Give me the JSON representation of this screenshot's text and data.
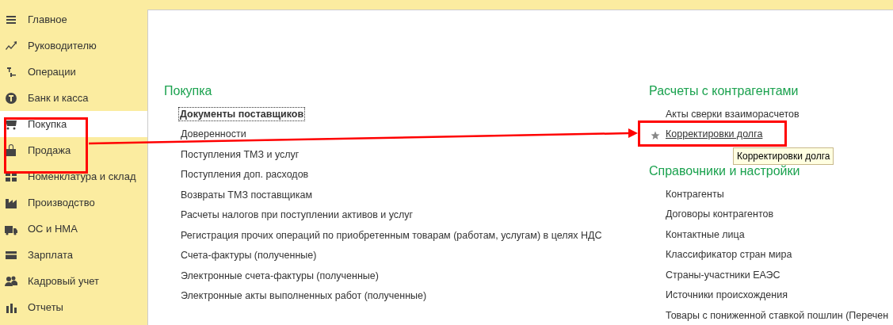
{
  "sidebar": {
    "items": [
      {
        "label": "Главное",
        "selected": false
      },
      {
        "label": "Руководителю",
        "selected": false
      },
      {
        "label": "Операции",
        "selected": false
      },
      {
        "label": "Банк и касса",
        "selected": false
      },
      {
        "label": "Покупка",
        "selected": true
      },
      {
        "label": "Продажа",
        "selected": false
      },
      {
        "label": "Номенклатура и склад",
        "selected": false
      },
      {
        "label": "Производство",
        "selected": false
      },
      {
        "label": "ОС и НМА",
        "selected": false
      },
      {
        "label": "Зарплата",
        "selected": false
      },
      {
        "label": "Кадровый учет",
        "selected": false
      },
      {
        "label": "Отчеты",
        "selected": false
      }
    ]
  },
  "sections": [
    {
      "title": "Покупка",
      "items": [
        {
          "label": "Документы поставщиков",
          "focused": true,
          "favorite": false,
          "hovered": false
        },
        {
          "label": "Доверенности",
          "focused": false,
          "favorite": false,
          "hovered": false
        },
        {
          "label": "Поступления ТМЗ и услуг",
          "focused": false,
          "favorite": false,
          "hovered": false
        },
        {
          "label": "Поступления доп. расходов",
          "focused": false,
          "favorite": false,
          "hovered": false
        },
        {
          "label": "Возвраты ТМЗ поставщикам",
          "focused": false,
          "favorite": false,
          "hovered": false
        },
        {
          "label": "Расчеты налогов при поступлении активов и услуг",
          "focused": false,
          "favorite": false,
          "hovered": false
        },
        {
          "label": "Регистрация прочих операций по приобретенным товарам (работам, услугам) в целях НДС",
          "focused": false,
          "favorite": false,
          "hovered": false
        },
        {
          "label": "Счета-фактуры (полученные)",
          "focused": false,
          "favorite": false,
          "hovered": false
        },
        {
          "label": "Электронные счета-фактуры (полученные)",
          "focused": false,
          "favorite": false,
          "hovered": false
        },
        {
          "label": "Электронные акты выполненных работ (полученные)",
          "focused": false,
          "favorite": false,
          "hovered": false
        }
      ]
    },
    {
      "title": "Расчеты с контрагентами",
      "items": [
        {
          "label": "Акты сверки взаиморасчетов",
          "focused": false,
          "favorite": false,
          "hovered": false
        },
        {
          "label": "Корректировки долга",
          "focused": false,
          "favorite": true,
          "hovered": true
        }
      ]
    },
    {
      "title": "Справочники и настройки",
      "items": [
        {
          "label": "Контрагенты",
          "focused": false,
          "favorite": false,
          "hovered": false
        },
        {
          "label": "Договоры контрагентов",
          "focused": false,
          "favorite": false,
          "hovered": false
        },
        {
          "label": "Контактные лица",
          "focused": false,
          "favorite": false,
          "hovered": false
        },
        {
          "label": "Классификатор стран мира",
          "focused": false,
          "favorite": false,
          "hovered": false
        },
        {
          "label": "Страны-участники ЕАЭС",
          "focused": false,
          "favorite": false,
          "hovered": false
        },
        {
          "label": "Источники происхождения",
          "focused": false,
          "favorite": false,
          "hovered": false
        },
        {
          "label": "Товары с пониженной ставкой пошлин (Перечен",
          "focused": false,
          "favorite": false,
          "hovered": false
        }
      ]
    }
  ],
  "tooltip": {
    "text": "Корректировки долга"
  }
}
